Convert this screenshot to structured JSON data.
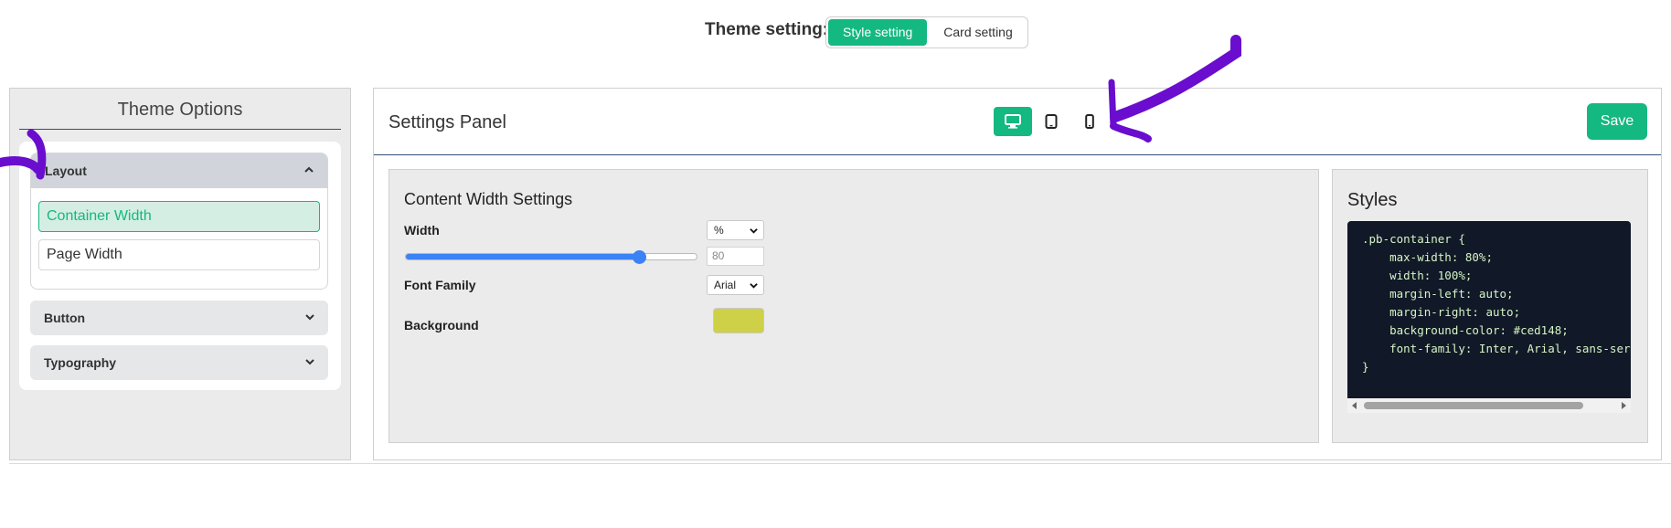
{
  "theme_setting": {
    "label": "Theme setting:",
    "options": [
      "Style setting",
      "Card setting"
    ],
    "active": "Style setting"
  },
  "sidebar": {
    "title": "Theme Options",
    "sections": [
      {
        "label": "Layout",
        "expanded": true,
        "items": [
          "Container Width",
          "Page Width"
        ],
        "active_item": "Container Width"
      },
      {
        "label": "Button",
        "expanded": false
      },
      {
        "label": "Typography",
        "expanded": false
      }
    ]
  },
  "panel": {
    "title": "Settings Panel",
    "devices": [
      "desktop-icon",
      "tablet-icon",
      "mobile-icon"
    ],
    "active_device": "desktop",
    "save_label": "Save"
  },
  "content_width": {
    "title": "Content Width Settings",
    "width_label": "Width",
    "unit": "%",
    "width_value": "80",
    "slider_fraction": 0.8,
    "font_label": "Font Family",
    "font_value": "Arial",
    "background_label": "Background",
    "background_color": "#ced148"
  },
  "styles": {
    "title": "Styles",
    "code": ".pb-container {\n    max-width: 80%;\n    width: 100%;\n    margin-left: auto;\n    margin-right: auto;\n    background-color: #ced148;\n    font-family: Inter, Arial, sans-serif;\n}"
  },
  "colors": {
    "accent": "#14b881",
    "annotation_arrow": "#6a0dce",
    "slider": "#3b82f6"
  }
}
